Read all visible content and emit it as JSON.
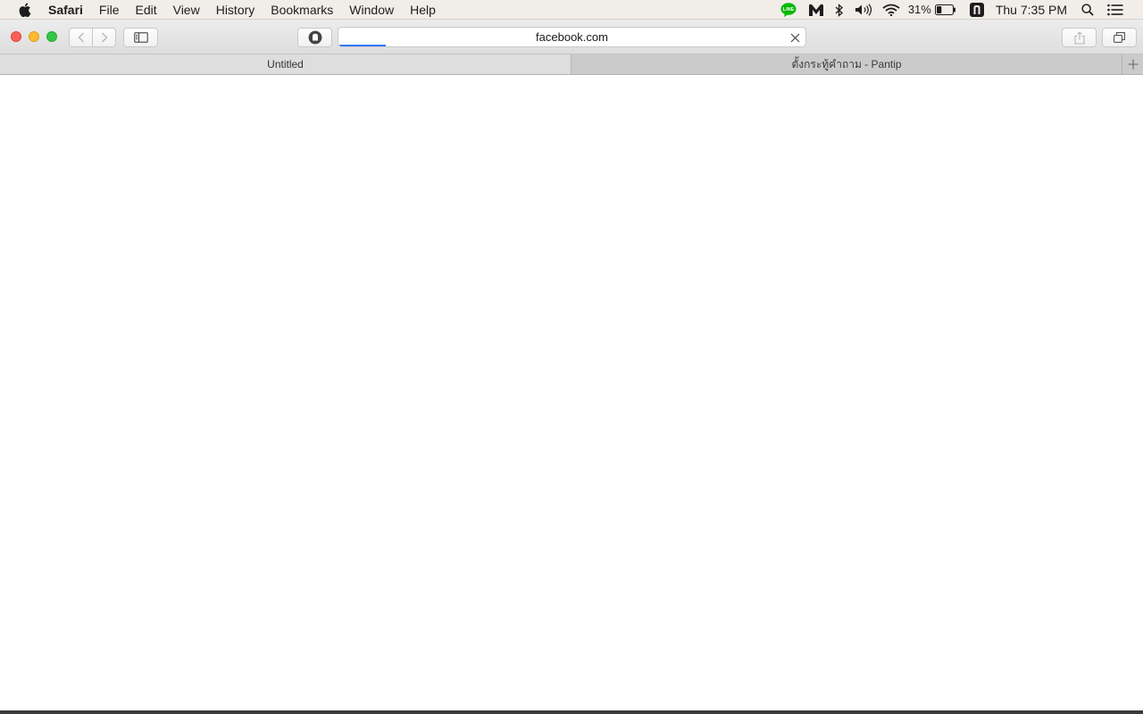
{
  "menubar": {
    "apple_icon": "apple-logo-icon",
    "items": [
      {
        "label": "Safari"
      },
      {
        "label": "File"
      },
      {
        "label": "Edit"
      },
      {
        "label": "View"
      },
      {
        "label": "History"
      },
      {
        "label": "Bookmarks"
      },
      {
        "label": "Window"
      },
      {
        "label": "Help"
      }
    ],
    "status": {
      "line_icon_text": "LINE",
      "line_color": "#00b900",
      "battery_percent": "31%",
      "battery_level": 0.31,
      "clock": "Thu 7:35 PM"
    }
  },
  "toolbar": {
    "url": "facebook.com",
    "progress_fraction": 0.1,
    "progress_color": "#3478f6"
  },
  "tabs": [
    {
      "title": "Untitled",
      "active": true
    },
    {
      "title": "ตั้งกระทู้คำถาม - Pantip",
      "active": false
    }
  ],
  "colors": {
    "close": "#fc5f57",
    "minimize": "#fdbb2e",
    "maximize": "#33c748"
  }
}
